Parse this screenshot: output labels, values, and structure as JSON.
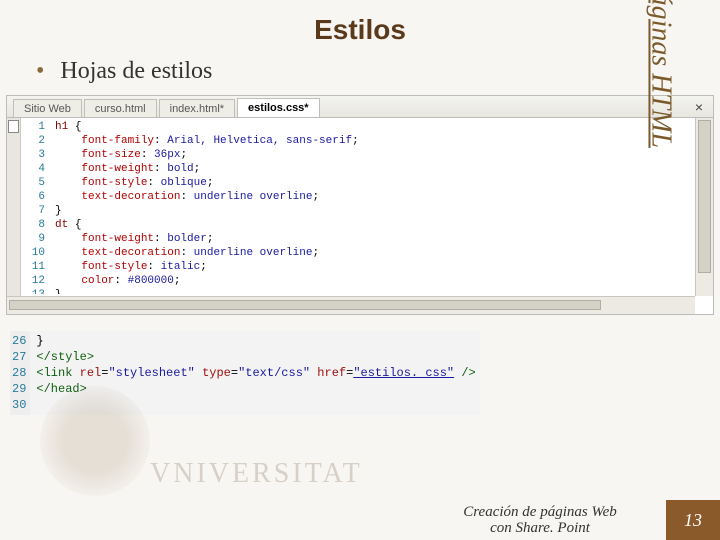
{
  "title": "Estilos",
  "bullet": "Hojas de estilos",
  "side_label": "Páginas HTML",
  "editor": {
    "tabs": [
      "Sitio Web",
      "curso.html",
      "index.html*",
      "estilos.css*"
    ],
    "active_tab_index": 3,
    "lines": {
      "1": {
        "s": "h1",
        "b": "{"
      },
      "2": {
        "p": "font-family",
        "v": "Arial, Helvetica, sans-serif"
      },
      "3": {
        "p": "font-size",
        "v": "36px"
      },
      "4": {
        "p": "font-weight",
        "v": "bold"
      },
      "5": {
        "p": "font-style",
        "v": "oblique"
      },
      "6": {
        "p": "text-decoration",
        "v": "underline overline"
      },
      "7": {
        "b": "}"
      },
      "8": {
        "s": "dt",
        "b": "{"
      },
      "9": {
        "p": "font-weight",
        "v": "bolder"
      },
      "10": {
        "p": "text-decoration",
        "v": "underline overline"
      },
      "11": {
        "p": "font-style",
        "v": "italic"
      },
      "12": {
        "p": "color",
        "v": "#800000"
      },
      "13": {
        "b": "}"
      },
      "14": {
        "blank": true
      }
    }
  },
  "snippet": {
    "start": 26,
    "lines": [
      {
        "n": 26,
        "t": "}"
      },
      {
        "n": 27,
        "t": "</style>"
      },
      {
        "n": 28,
        "pre": "<link ",
        "attrs": [
          {
            "a": "rel",
            "v": "\"stylesheet\""
          },
          {
            "a": "type",
            "v": "\"text/css\""
          },
          {
            "a": "href",
            "v": "\"estilos. css\"",
            "u": true
          }
        ],
        "post": " />"
      },
      {
        "n": 29,
        "t": "</head>"
      },
      {
        "n": 30,
        "t": ""
      }
    ]
  },
  "watermark": "VNIVERSITAT",
  "footer": {
    "caption_line1": "Creación de páginas Web",
    "caption_line2": "con Share. Point",
    "page": "13"
  }
}
